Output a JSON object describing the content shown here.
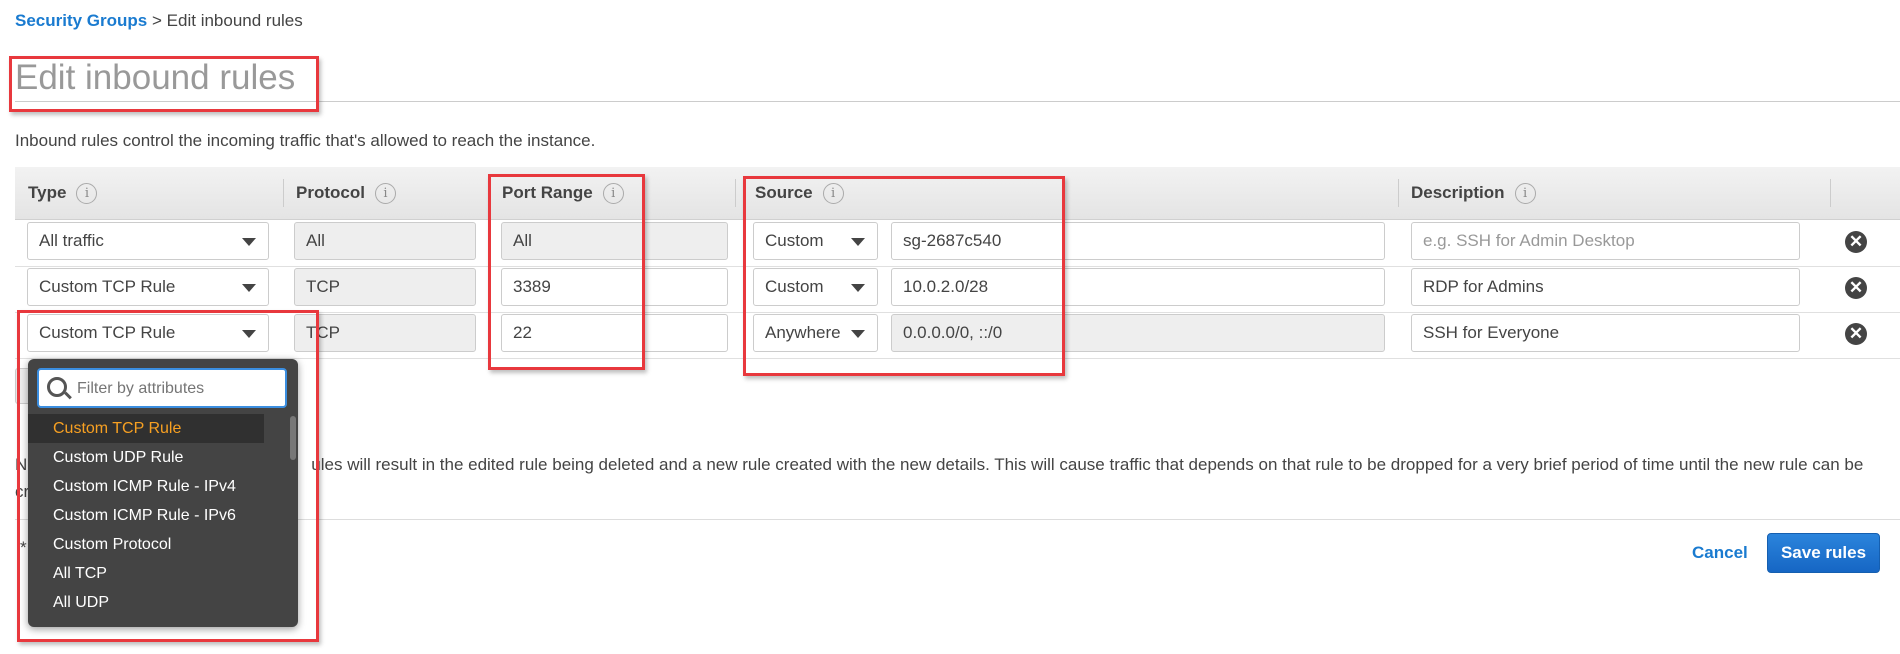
{
  "breadcrumb": {
    "parent": "Security Groups",
    "separator": ">",
    "current": "Edit inbound rules"
  },
  "page_title": "Edit inbound rules",
  "intro": "Inbound rules control the incoming traffic that's allowed to reach the instance.",
  "table": {
    "headers": [
      "Type",
      "Protocol",
      "Port Range",
      "Source",
      "Description"
    ],
    "info_icon": "i",
    "rows": [
      {
        "type": "All traffic",
        "protocol": "All",
        "port_range": "All",
        "port_readonly": true,
        "source_type": "Custom",
        "source_value": "sg-2687c540",
        "source_readonly": false,
        "description": "",
        "description_placeholder": "e.g. SSH for Admin Desktop"
      },
      {
        "type": "Custom TCP Rule",
        "protocol": "TCP",
        "port_range": "3389",
        "port_readonly": false,
        "source_type": "Custom",
        "source_value": "10.0.2.0/28",
        "source_readonly": false,
        "description": "RDP for Admins",
        "description_placeholder": ""
      },
      {
        "type": "Custom TCP Rule",
        "protocol": "TCP",
        "port_range": "22",
        "port_readonly": false,
        "source_type": "Anywhere",
        "source_value": "0.0.0.0/0, ::/0",
        "source_readonly": true,
        "description": "SSH for Everyone",
        "description_placeholder": ""
      }
    ],
    "remove_icon": "✕"
  },
  "note": {
    "visible_start": "N",
    "visible_line1": "ules will result in the edited rule being deleted and a new rule created with the new details. This will cause traffic that depends on that rule to be dropped for a very brief period of time until the new rule can be",
    "visible_line2_start": "cr"
  },
  "footer": {
    "required_marker": "*",
    "cancel": "Cancel",
    "save": "Save rules"
  },
  "dropdown": {
    "filter_placeholder": "Filter by attributes",
    "options": [
      "Custom TCP Rule",
      "Custom UDP Rule",
      "Custom ICMP Rule - IPv4",
      "Custom ICMP Rule - IPv6",
      "Custom Protocol",
      "All TCP",
      "All UDP"
    ],
    "selected": "Custom TCP Rule"
  },
  "colors": {
    "link": "#1a7bd0",
    "highlight_box": "#e8383d",
    "dropdown_bg": "#444444",
    "selected_option": "#f7a022",
    "primary_button": "#1f74d0"
  }
}
